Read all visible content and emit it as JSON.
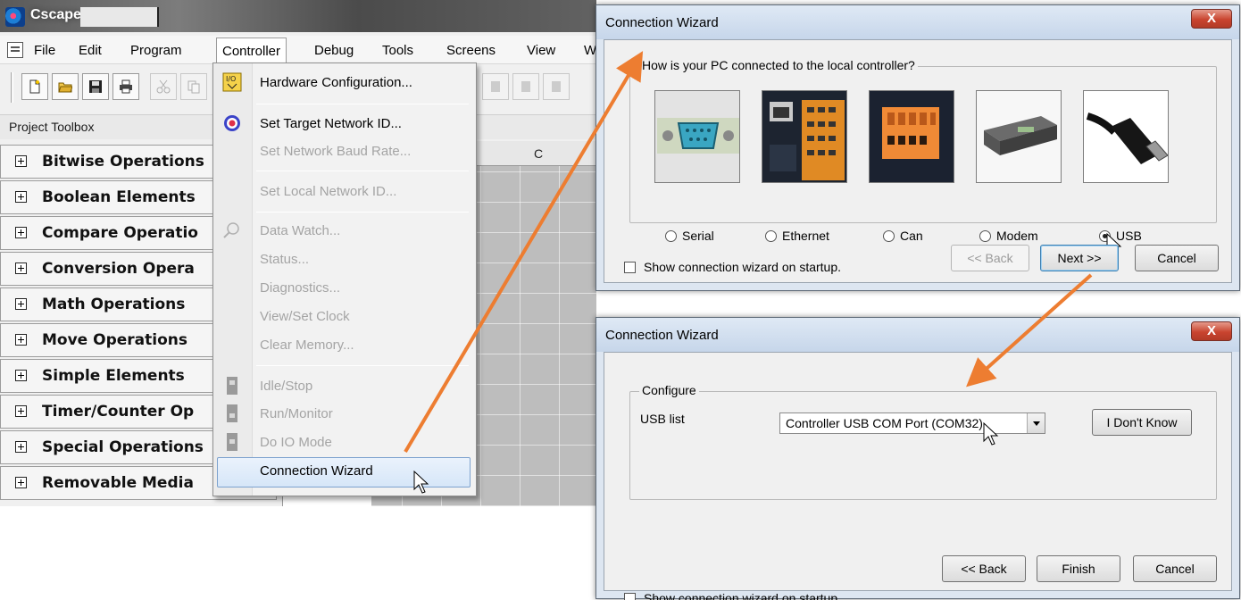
{
  "app": {
    "title": "Cscape",
    "menus": [
      "File",
      "Edit",
      "Program",
      "Controller",
      "Debug",
      "Tools",
      "Screens",
      "View",
      "W"
    ],
    "open_menu": "Controller",
    "project_toolbox_title": "Project Toolbox",
    "toolbox_items": [
      "Bitwise Operations",
      "Boolean Elements",
      "Compare Operatio",
      "Conversion Opera",
      "Math Operations",
      "Move Operations",
      "Simple Elements",
      "Timer/Counter Op",
      "Special Operations",
      "Removable Media"
    ],
    "ladder_column_label": "C",
    "toolbar_icons": [
      "new-file-icon",
      "open-folder-icon",
      "save-icon",
      "print-icon",
      "cut-icon",
      "copy-icon"
    ]
  },
  "controller_menu": {
    "items": [
      {
        "label": "Hardware Configuration...",
        "enabled": true,
        "icon": "hardware-config-icon"
      },
      {
        "label": "Set Target Network ID...",
        "enabled": true,
        "icon": "target-icon"
      },
      {
        "label": "Set Network Baud Rate...",
        "enabled": false
      },
      {
        "label": "Set Local Network ID...",
        "enabled": false
      },
      {
        "label": "Data Watch...",
        "enabled": false,
        "icon": "magnifier-icon"
      },
      {
        "label": "Status...",
        "enabled": false
      },
      {
        "label": "Diagnostics...",
        "enabled": false
      },
      {
        "label": "View/Set Clock",
        "enabled": false
      },
      {
        "label": "Clear Memory...",
        "enabled": false
      },
      {
        "label": "Idle/Stop",
        "enabled": false,
        "icon": "idle-stop-icon"
      },
      {
        "label": "Run/Monitor",
        "enabled": false,
        "icon": "run-monitor-icon"
      },
      {
        "label": "Do IO Mode",
        "enabled": false,
        "icon": "io-mode-icon"
      },
      {
        "label": "Connection Wizard",
        "enabled": true,
        "highlighted": true
      }
    ]
  },
  "wizard1": {
    "title": "Connection Wizard",
    "close": "X",
    "question": "How is your PC connected to the local controller?",
    "options": [
      {
        "label": "Serial",
        "selected": false
      },
      {
        "label": "Ethernet",
        "selected": false
      },
      {
        "label": "Can",
        "selected": false
      },
      {
        "label": "Modem",
        "selected": false
      },
      {
        "label": "USB",
        "selected": true
      }
    ],
    "show_on_startup": "Show connection wizard on startup.",
    "buttons": {
      "back": "<< Back",
      "next": "Next >>",
      "cancel": "Cancel"
    }
  },
  "wizard2": {
    "title": "Connection Wizard",
    "close": "X",
    "group_label": "Configure",
    "usb_list_label": "USB list",
    "usb_list_value": "Controller USB COM Port (COM32)",
    "dont_know": "I Don't Know",
    "show_on_startup": "Show connection wizard on startup.",
    "buttons": {
      "back": "<< Back",
      "finish": "Finish",
      "cancel": "Cancel"
    }
  },
  "colors": {
    "arrow": "#ED7D31",
    "menu_highlight": "#D6E6F8",
    "close_button": "#C9442F"
  }
}
